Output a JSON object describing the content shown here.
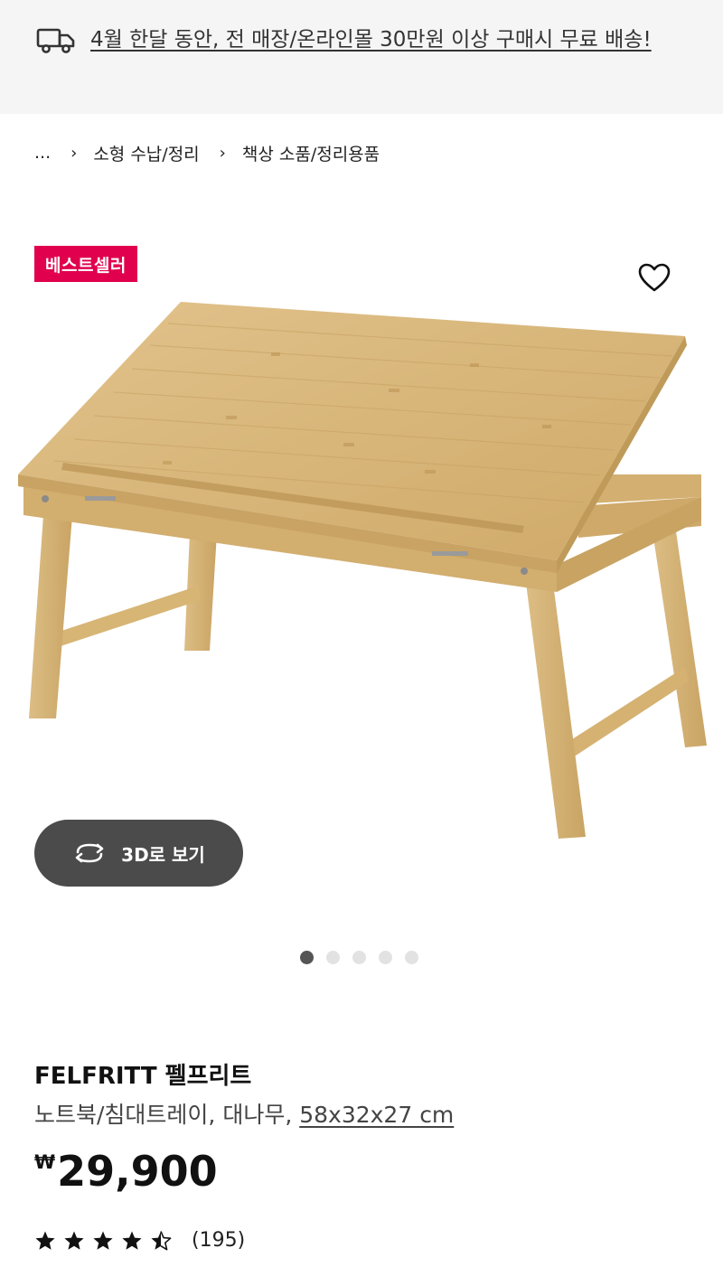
{
  "banner": {
    "message": "4월 한달 동안, 전 매장/온라인몰 30만원 이상 구매시 무료 배송!",
    "icon": "truck-icon"
  },
  "breadcrumb": {
    "ellipsis": "...",
    "items": [
      "소형 수납/정리",
      "책상 소품/정리용품"
    ],
    "separator_icon": "chevron-right-icon"
  },
  "gallery": {
    "badge": "베스트셀러",
    "badge_color": "#e0004d",
    "favorite_icon": "heart-icon",
    "view_3d_label": "3D로 보기",
    "view_3d_icon": "rotate-3d-icon",
    "dot_count": 5,
    "active_dot": 1
  },
  "product": {
    "name": "FELFRITT 펠프리트",
    "description": "노트북/침대트레이, 대나무, ",
    "dimensions": "58x32x27 cm",
    "currency": "₩",
    "price": "29,900",
    "rating": 4.5,
    "review_count": "(195)"
  }
}
